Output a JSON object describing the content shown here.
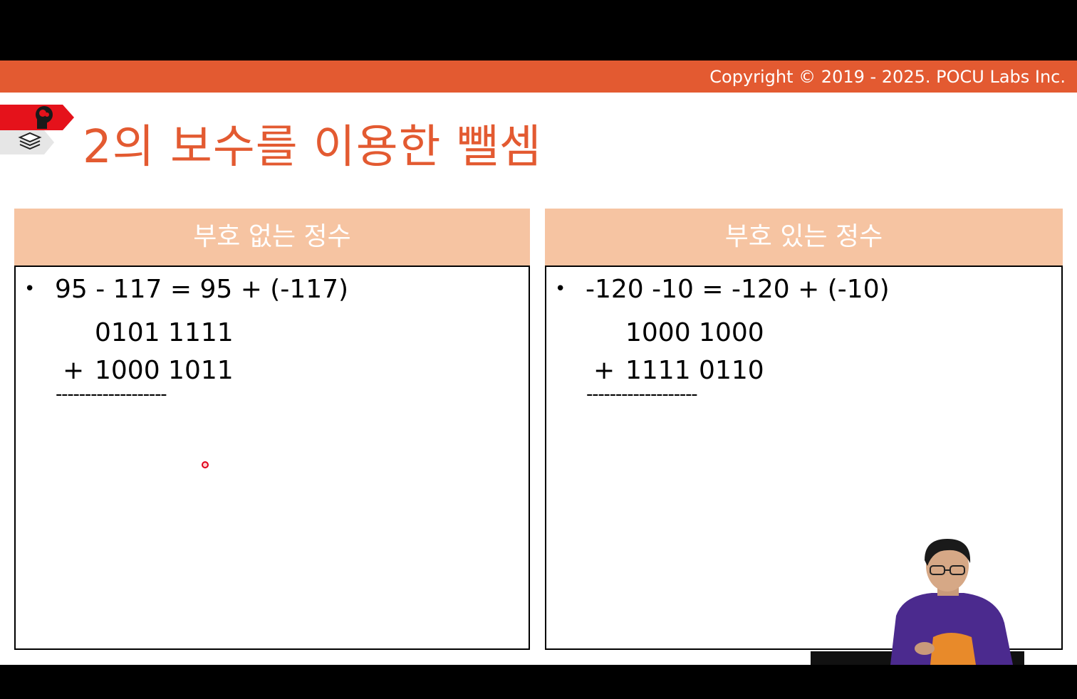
{
  "slide": {
    "copyright": "Copyright © 2019 - 2025. POCU Labs Inc.",
    "title": "2의 보수를 이용한 뺄셈",
    "icons": [
      "brain-head-icon",
      "stack-layers-icon"
    ]
  },
  "panels": {
    "left": {
      "header": "부호 없는 정수",
      "bullet": "•",
      "equation": "95 - 117 = 95 + (-117)",
      "line1": "0101 1111",
      "operator": "+",
      "line2": "1000 1011",
      "separator": "-------------------"
    },
    "right": {
      "header": "부호 있는 정수",
      "bullet": "•",
      "equation": "-120 -10 = -120 + (-10)",
      "line1": "1000 1000",
      "operator": "+",
      "line2": "1111 0110",
      "separator": "-------------------"
    }
  },
  "colors": {
    "accent": "#E35A31",
    "panel_header": "#F6C4A2",
    "badge_red": "#E5121B",
    "badge_gray": "#E6E6E6"
  }
}
